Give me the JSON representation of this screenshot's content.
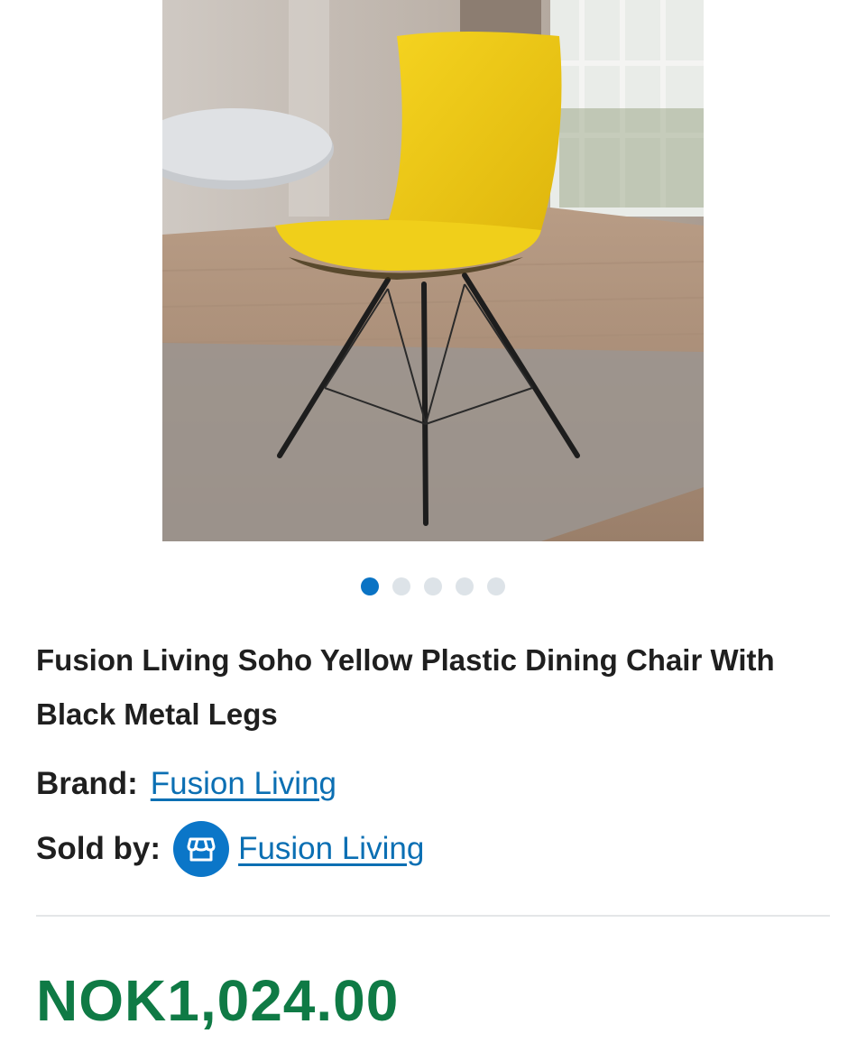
{
  "product": {
    "image_alt": "Yellow plastic dining chair with black metal legs",
    "carousel": {
      "total_slides": 5,
      "active_index": 0
    },
    "title": "Fusion Living Soho Yellow Plastic Dining Chair With Black Metal Legs",
    "brand_label": "Brand:",
    "brand_name": "Fusion Living",
    "sold_by_label": "Sold by:",
    "seller_name": "Fusion Living",
    "seller_icon": "store-icon",
    "price": "NOK1,024.00"
  },
  "colors": {
    "accent_blue": "#0b76c8",
    "link_blue": "#0b6fb3",
    "price_green": "#0f7a45",
    "dot_inactive": "#dde3e8",
    "chair_yellow": "#f2cf15"
  }
}
